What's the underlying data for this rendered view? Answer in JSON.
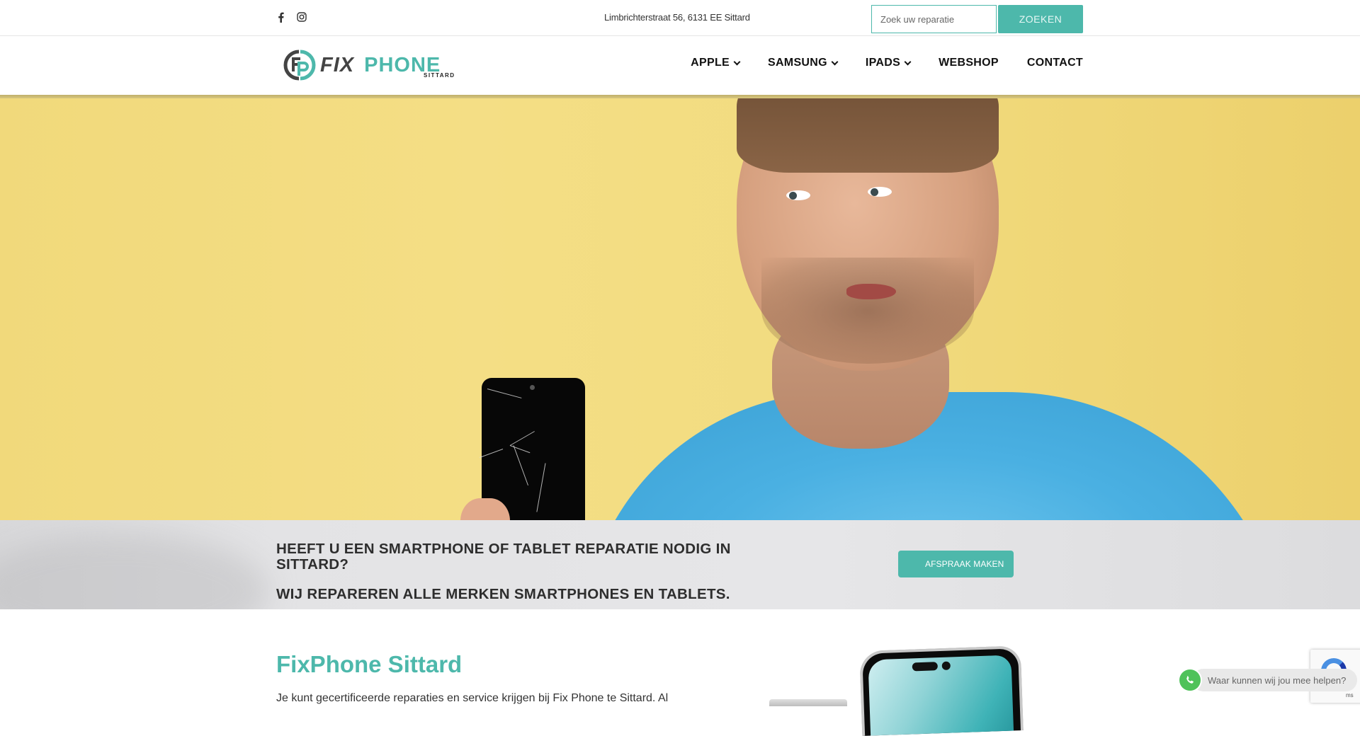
{
  "topbar": {
    "social": [
      {
        "icon": "facebook-icon",
        "glyph": "f"
      },
      {
        "icon": "instagram-icon"
      }
    ],
    "address": "Limbrichterstraat 56, 6131 EE Sittard",
    "search": {
      "placeholder": "Zoek uw reparatie",
      "value": "",
      "button_label": "ZOEKEN"
    }
  },
  "header": {
    "logo": {
      "word1": "FIX",
      "word2": "PHONE",
      "sub": "SITTARD"
    },
    "nav": [
      {
        "label": "APPLE",
        "has_dropdown": true
      },
      {
        "label": "SAMSUNG",
        "has_dropdown": true
      },
      {
        "label": "IPADS",
        "has_dropdown": true
      },
      {
        "label": "WEBSHOP",
        "has_dropdown": false
      },
      {
        "label": "CONTACT",
        "has_dropdown": false
      }
    ]
  },
  "banner": {
    "heading": "HEEFT U EEN SMARTPHONE OF TABLET REPARATIE NODIG IN SITTARD?",
    "subheading": "WIJ REPAREREN ALLE MERKEN SMARTPHONES EN TABLETS.",
    "cta_label": "AFSPRAAK MAKEN"
  },
  "intro": {
    "title": "FixPhone Sittard",
    "text": "Je kunt gecertificeerde reparaties en service krijgen bij Fix Phone te Sittard. Al"
  },
  "recaptcha": {
    "text": "ms"
  },
  "whatsapp": {
    "message": "Waar kunnen wij jou mee helpen?"
  },
  "colors": {
    "brand": "#4db8ab",
    "text_dark": "#2e2e2e",
    "whatsapp": "#4fc25a"
  }
}
